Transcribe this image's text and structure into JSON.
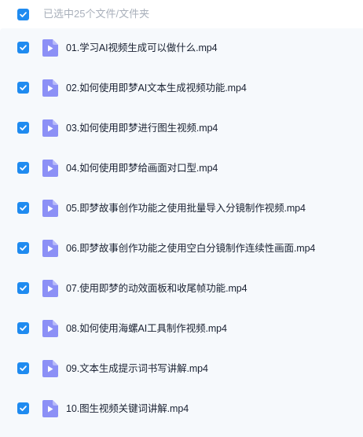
{
  "header": {
    "select_all_checked": true,
    "selection_text": "已选中25个文件/文件夹"
  },
  "colors": {
    "accent": "#1f8bf0",
    "file_icon": "#8c90f6",
    "list_bg": "#f6f9fc"
  },
  "files": [
    {
      "name": "01.学习AI视频生成可以做什么.mp4",
      "checked": true,
      "icon": "video-file-icon"
    },
    {
      "name": "02.如何使用即梦AI文本生成视频功能.mp4",
      "checked": true,
      "icon": "video-file-icon"
    },
    {
      "name": "03.如何使用即梦进行图生视频.mp4",
      "checked": true,
      "icon": "video-file-icon"
    },
    {
      "name": "04.如何使用即梦给画面对口型.mp4",
      "checked": true,
      "icon": "video-file-icon"
    },
    {
      "name": "05.即梦故事创作功能之使用批量导入分镜制作视频.mp4",
      "checked": true,
      "icon": "video-file-icon"
    },
    {
      "name": "06.即梦故事创作功能之使用空白分镜制作连续性画面.mp4",
      "checked": true,
      "icon": "video-file-icon"
    },
    {
      "name": "07.使用即梦的动效面板和收尾帧功能.mp4",
      "checked": true,
      "icon": "video-file-icon"
    },
    {
      "name": "08.如何使用海螺AI工具制作视频.mp4",
      "checked": true,
      "icon": "video-file-icon"
    },
    {
      "name": "09.文本生成提示词书写讲解.mp4",
      "checked": true,
      "icon": "video-file-icon"
    },
    {
      "name": "10.图生视频关键词讲解.mp4",
      "checked": true,
      "icon": "video-file-icon"
    }
  ]
}
